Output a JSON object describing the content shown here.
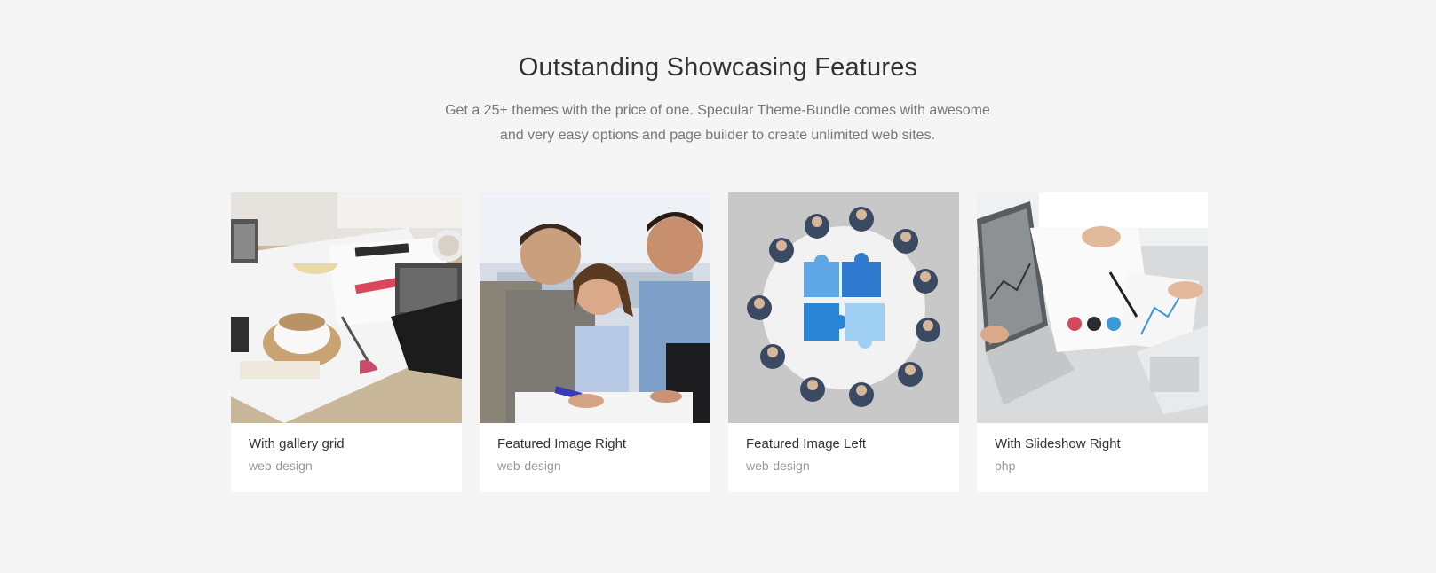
{
  "section": {
    "heading": "Outstanding Showcasing Features",
    "subtitle_line1": "Get a 25+ themes with the price of one. Specular Theme-Bundle comes with awesome",
    "subtitle_line2": "and very easy options and page builder to create unlimited web sites."
  },
  "cards": [
    {
      "title": "With gallery grid",
      "category": "web-design",
      "image": "office-desk-coffee-tablet-photo"
    },
    {
      "title": "Featured Image Right",
      "category": "web-design",
      "image": "team-meeting-smiling-people-photo"
    },
    {
      "title": "Featured Image Left",
      "category": "web-design",
      "image": "round-table-puzzle-teamwork-photo"
    },
    {
      "title": "With Slideshow Right",
      "category": "php",
      "image": "laptop-documents-charts-photo"
    }
  ]
}
